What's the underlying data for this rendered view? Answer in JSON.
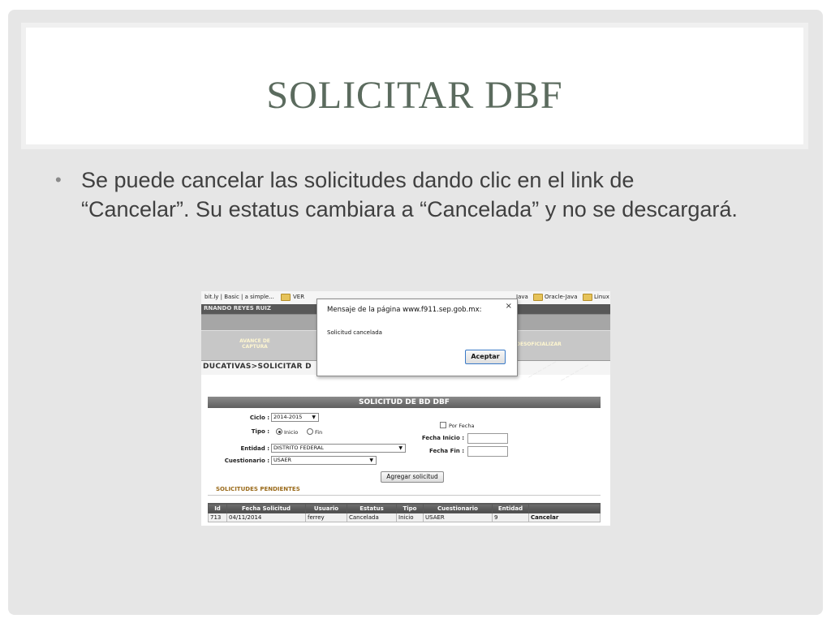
{
  "slide": {
    "title": "SOLICITAR DBF",
    "bullet": "Se puede cancelar las solicitudes dando clic en el link de “Cancelar”. Su estatus cambiara a “Cancelada” y no se descargará."
  },
  "screenshot": {
    "bookmarks": {
      "item1": "bit.ly | Basic | a simple...",
      "item2": "VER",
      "item3": "Java",
      "item4": "Oracle-Java",
      "item5": "Linux"
    },
    "user_bar": "RNANDO REYES RUIZ",
    "menu": {
      "avance": "AVANCE DE CAPTURA",
      "desoficializar": "DESOFICIALIZAR"
    },
    "breadcrumb": "DUCATIVAS>SOLICITAR D",
    "form": {
      "header": "SOLICITUD DE BD DBF",
      "ciclo_label": "Ciclo :",
      "ciclo_value": "2014-2015",
      "tipo_label": "Tipo :",
      "tipo_inicio": "Inicio",
      "tipo_fin": "Fin",
      "entidad_label": "Entidad :",
      "entidad_value": "DISTRITO FEDERAL",
      "cuestionario_label": "Cuestionario :",
      "cuestionario_value": "USAER",
      "por_fecha": "Por Fecha",
      "fecha_inicio_label": "Fecha Inicio :",
      "fecha_fin_label": "Fecha Fin :",
      "agregar_button": "Agregar solicitud",
      "pendientes_title": "SOLICITUDES PENDIENTES"
    },
    "table": {
      "headers": [
        "Id",
        "Fecha Solicitud",
        "Usuario",
        "Estatus",
        "Tipo",
        "Cuestionario",
        "Entidad",
        ""
      ],
      "row": [
        "713",
        "04/11/2014",
        "ferrey",
        "Cancelada",
        "Inicio",
        "USAER",
        "9",
        "Cancelar"
      ]
    },
    "dialog": {
      "title": "Mensaje de la página www.f911.sep.gob.mx:",
      "message": "Solicitud cancelada",
      "ok_button": "Aceptar",
      "close": "×"
    }
  }
}
